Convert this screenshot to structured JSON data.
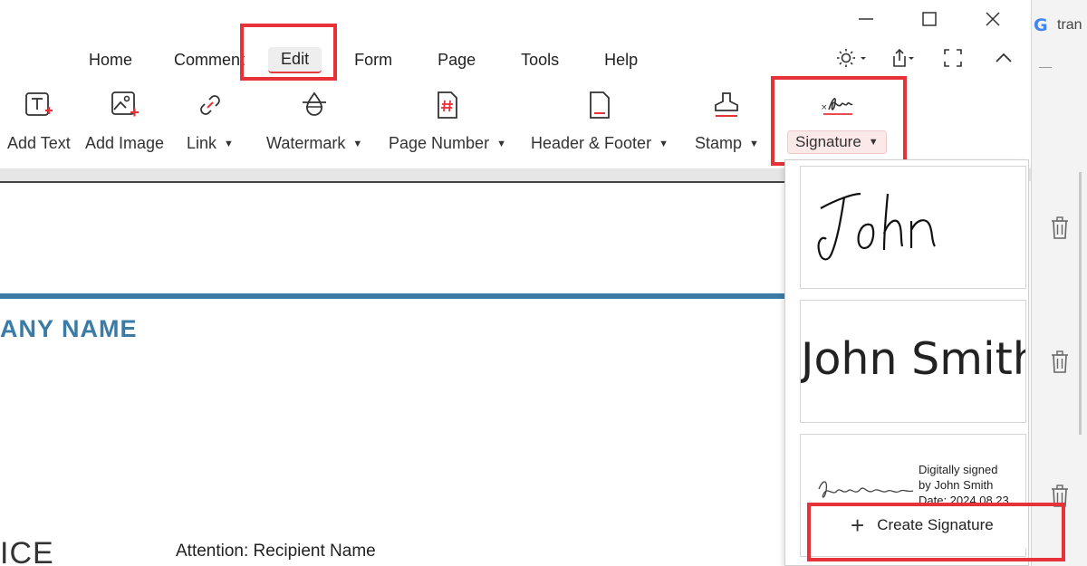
{
  "background_window": {
    "tab_partial_text": "tran"
  },
  "window_controls": {
    "minimize": "—",
    "maximize": "☐",
    "close": "✕"
  },
  "menu": {
    "tabs": [
      {
        "label": "Home"
      },
      {
        "label": "Comment"
      },
      {
        "label": "Edit",
        "active": true
      },
      {
        "label": "Form"
      },
      {
        "label": "Page"
      },
      {
        "label": "Tools"
      },
      {
        "label": "Help"
      }
    ]
  },
  "toolbar": {
    "tools": [
      {
        "label": "Add Text",
        "icon": "add-text-icon",
        "dropdown": false
      },
      {
        "label": "Add Image",
        "icon": "add-image-icon",
        "dropdown": false
      },
      {
        "label": "Link",
        "icon": "link-icon",
        "dropdown": true
      },
      {
        "label": "Watermark",
        "icon": "watermark-icon",
        "dropdown": true
      },
      {
        "label": "Page Number",
        "icon": "page-number-icon",
        "dropdown": true
      },
      {
        "label": "Header & Footer",
        "icon": "header-footer-icon",
        "dropdown": true
      },
      {
        "label": "Stamp",
        "icon": "stamp-icon",
        "dropdown": true
      },
      {
        "label": "Signature",
        "icon": "signature-icon",
        "dropdown": true
      }
    ]
  },
  "document": {
    "company_partial": "ANY NAME",
    "invoice_partial": "ICE",
    "attention": "Attention: Recipient Name"
  },
  "signature_panel": {
    "signatures": [
      {
        "type": "handwritten",
        "text": "John"
      },
      {
        "type": "typed",
        "text": "John Smith"
      },
      {
        "type": "digital",
        "line1": "Digitally signed",
        "line2": "by John Smith",
        "line3": "Date: 2024.08.23"
      }
    ],
    "create_label": "Create Signature",
    "create_icon": "plus-icon"
  },
  "colors": {
    "highlight": "#e8323a",
    "brand_blue": "#3a7ca5",
    "active_tab_underline": "#e03d3d"
  }
}
